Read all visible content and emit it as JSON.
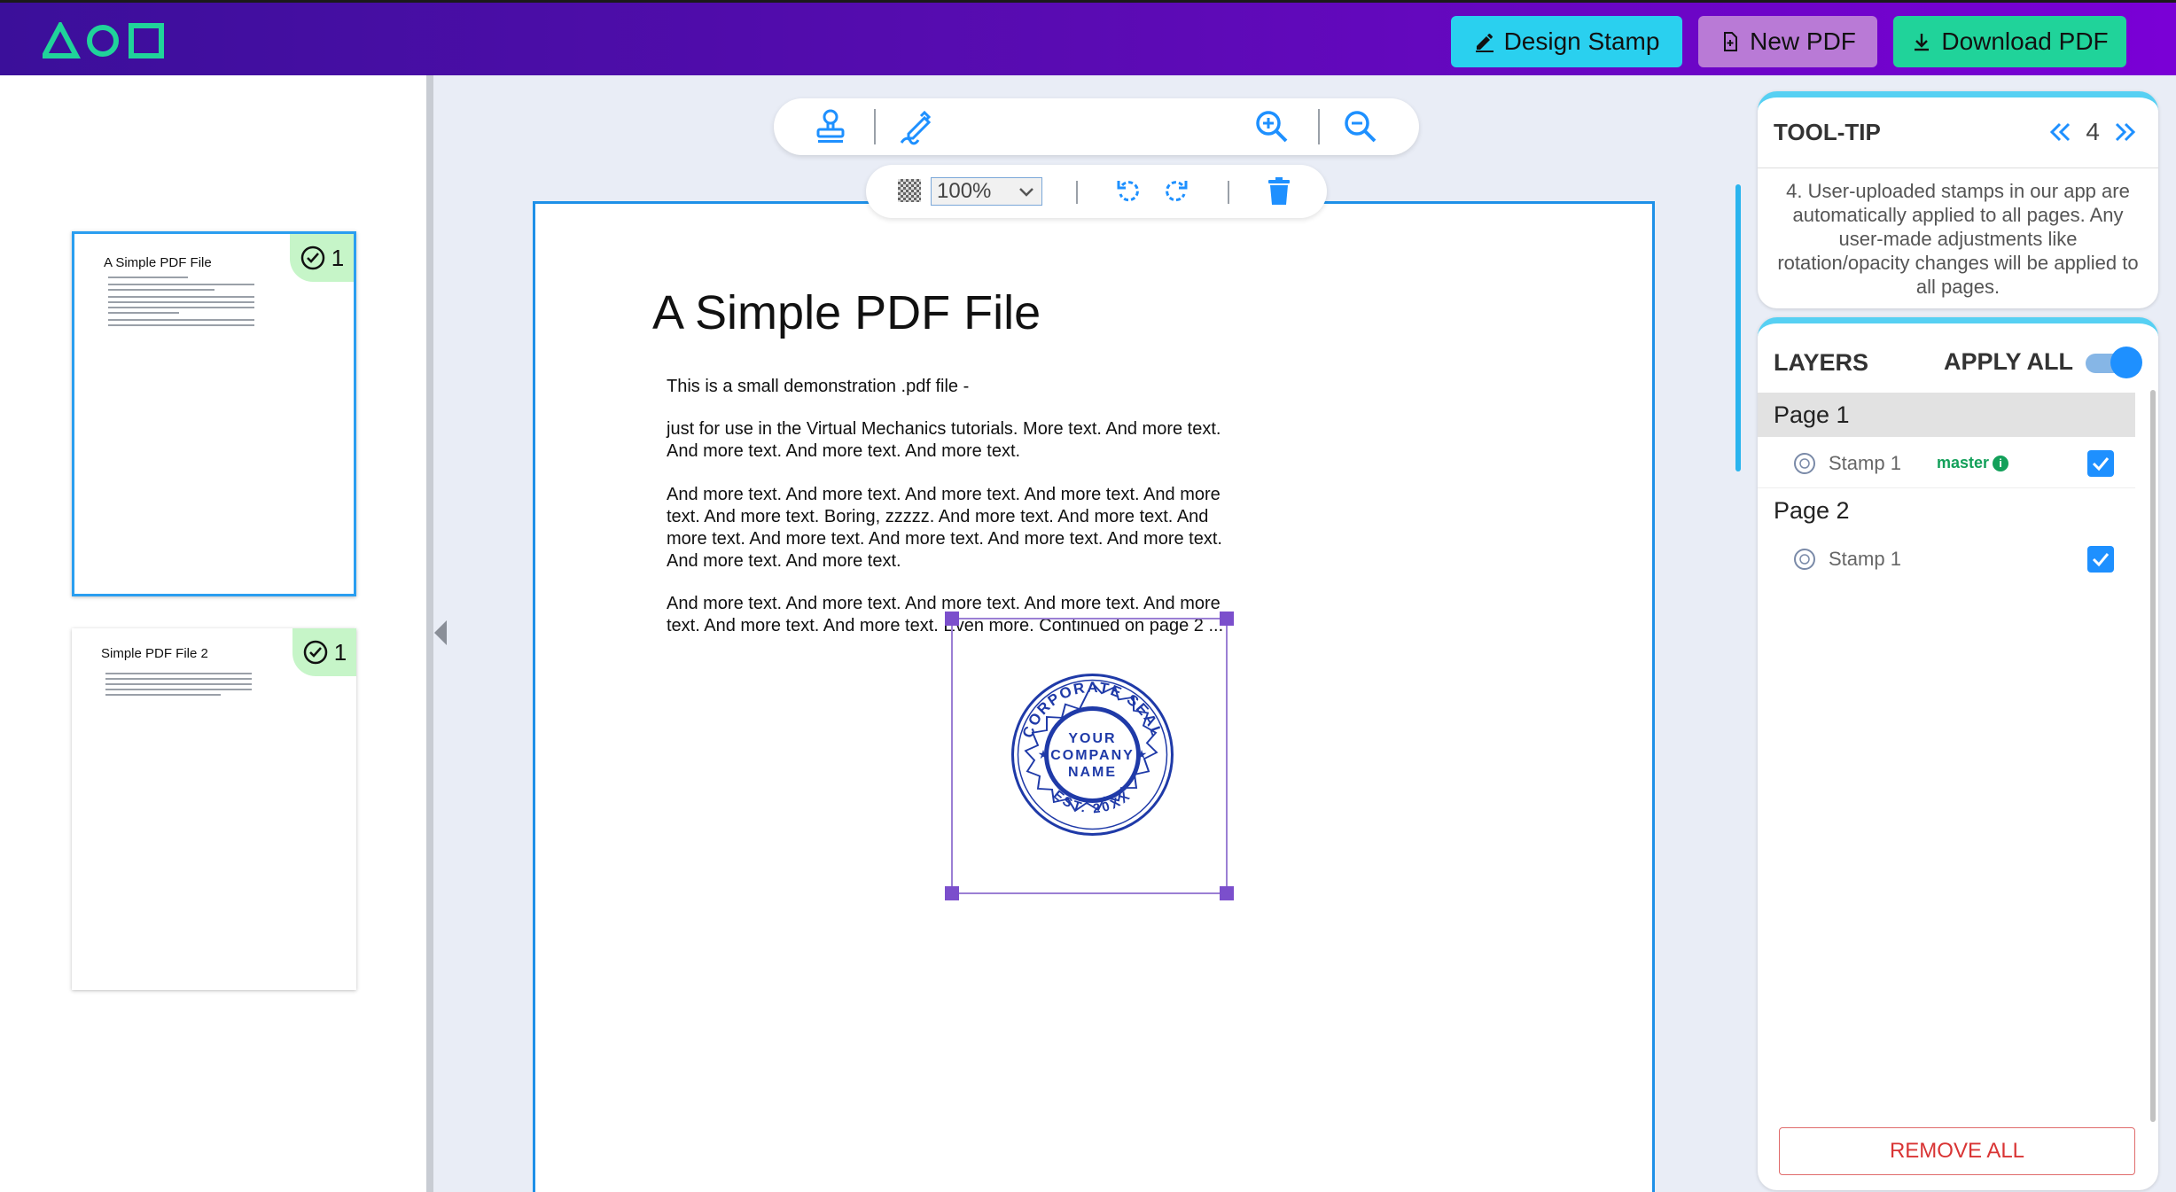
{
  "header": {
    "design_stamp": "Design Stamp",
    "new_pdf": "New PDF",
    "download_pdf": "Download PDF"
  },
  "thumbnails": [
    {
      "title": "A Simple PDF File",
      "badge": "1"
    },
    {
      "title": "Simple PDF File 2",
      "badge": "1"
    }
  ],
  "toolbar": {
    "zoom": "100%",
    "zoom_options": [
      "100%"
    ]
  },
  "document": {
    "title": "A Simple PDF File",
    "paragraphs": [
      "This is a small demonstration .pdf file -",
      "just for use in the Virtual Mechanics tutorials. More text. And more text. And more text. And more text. And more text.",
      "And more text. And more text. And more text. And more text. And more text. And more text. Boring, zzzzz. And more text. And more text. And more text. And more text. And more text. And more text. And more text. And more text. And more text.",
      "And more text. And more text. And more text. And more text. And more text. And more text. And more text. Even more. Continued on page 2 ..."
    ],
    "stamp": {
      "top_text": "CORPORATE SEAL",
      "center_lines": [
        "YOUR",
        "COMPANY",
        "NAME"
      ],
      "bottom_text": "EST. 20XX"
    }
  },
  "tooltip": {
    "title": "TOOL-TIP",
    "index": "4",
    "text": "4. User-uploaded stamps in our app are automatically applied to all pages. Any user-made adjustments like rotation/opacity changes will be applied to all pages."
  },
  "layers": {
    "title": "LAYERS",
    "apply_all": "APPLY ALL",
    "apply_all_on": true,
    "pages": [
      {
        "label": "Page 1",
        "stamps": [
          {
            "label": "Stamp 1",
            "master": "master",
            "checked": true
          }
        ]
      },
      {
        "label": "Page 2",
        "stamps": [
          {
            "label": "Stamp 1",
            "checked": true
          }
        ]
      }
    ],
    "remove_all": "REMOVE ALL"
  },
  "colors": {
    "accent": "#1e90ff",
    "header_start": "#3b0f9a",
    "header_end": "#7a00d6",
    "master_green": "#13a05a",
    "remove_red": "#d93434"
  }
}
